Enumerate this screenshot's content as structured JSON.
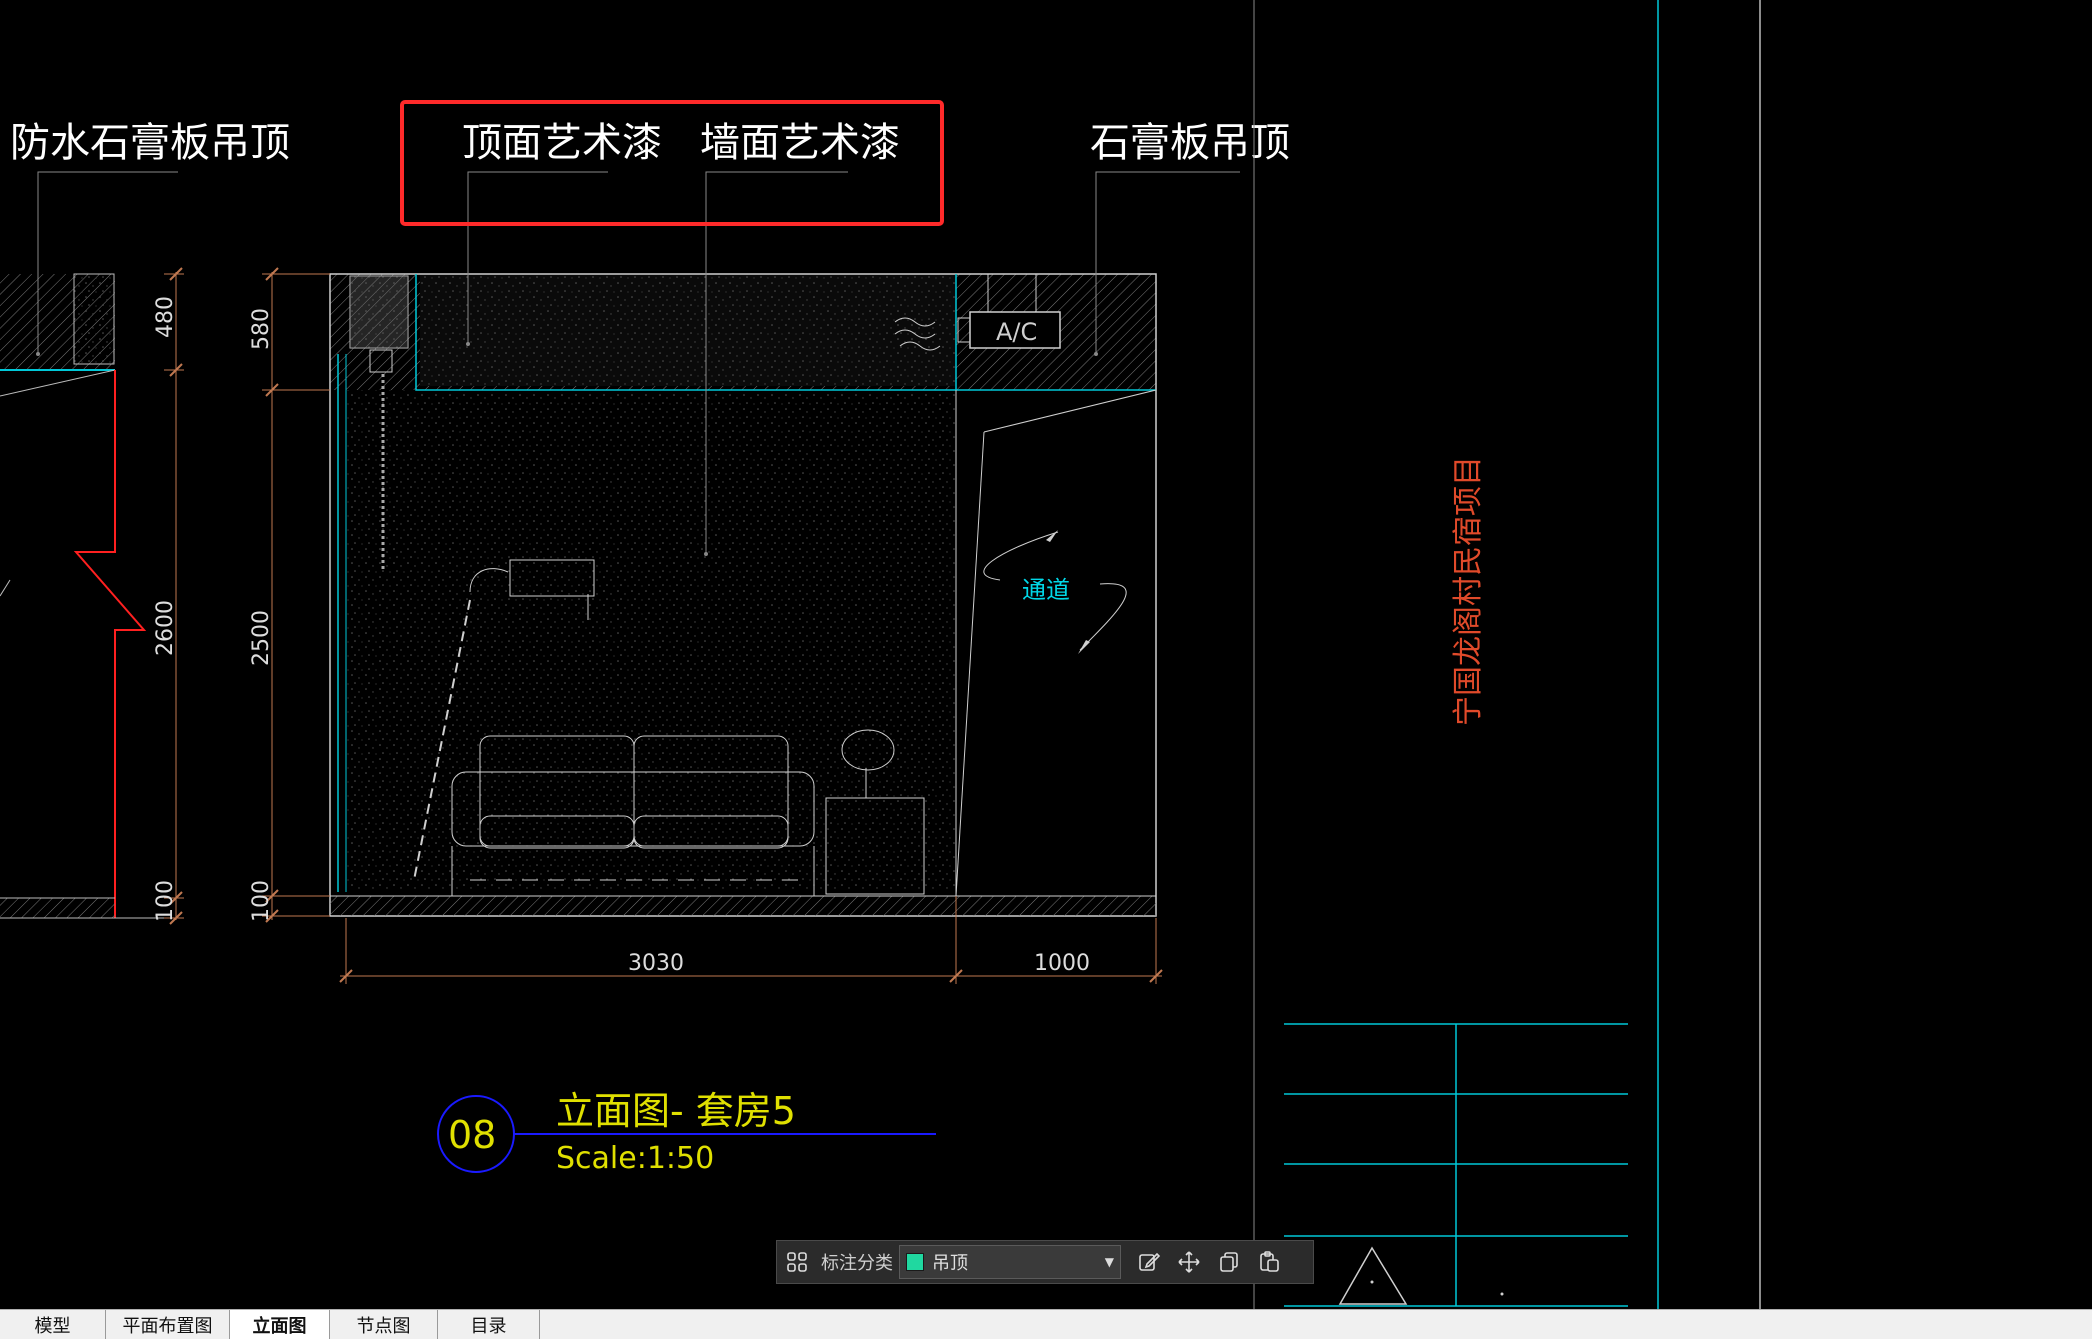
{
  "drawing": {
    "labels": {
      "waterproof_ceiling": "防水石膏板吊顶",
      "ceiling_art_paint": "顶面艺术漆",
      "wall_art_paint": "墙面艺术漆",
      "gypsum_ceiling": "石膏板吊顶"
    },
    "ac_label": "A/C",
    "passage_label": "通道",
    "dims": {
      "left_480": "480",
      "left_2600": "2600",
      "left_100": "100",
      "main_580": "580",
      "main_2500": "2500",
      "main_100": "100",
      "width_3030": "3030",
      "width_1000": "1000"
    },
    "title": {
      "number": "08",
      "name": "立面图- 套房5",
      "scale": "Scale:1:50"
    },
    "project_name": "宁国龙阁村民宿项目",
    "colors": {
      "highlight_box": "#ff2a2a",
      "cyan": "#00c8d8",
      "yellow": "#e0e000",
      "title_circle": "#1a1aff",
      "project_red": "#e04a2a"
    }
  },
  "toolbar": {
    "label": "标注分类",
    "layer_value": "吊顶",
    "layer_color": "#20d8a0",
    "icons": [
      "grid-icon",
      "edit-icon",
      "move-icon",
      "copy-icon",
      "paste-icon"
    ]
  },
  "tabs": [
    {
      "label": "模型",
      "active": false
    },
    {
      "label": "平面布置图",
      "active": false
    },
    {
      "label": "立面图",
      "active": true
    },
    {
      "label": "节点图",
      "active": false
    },
    {
      "label": "目录",
      "active": false
    }
  ]
}
